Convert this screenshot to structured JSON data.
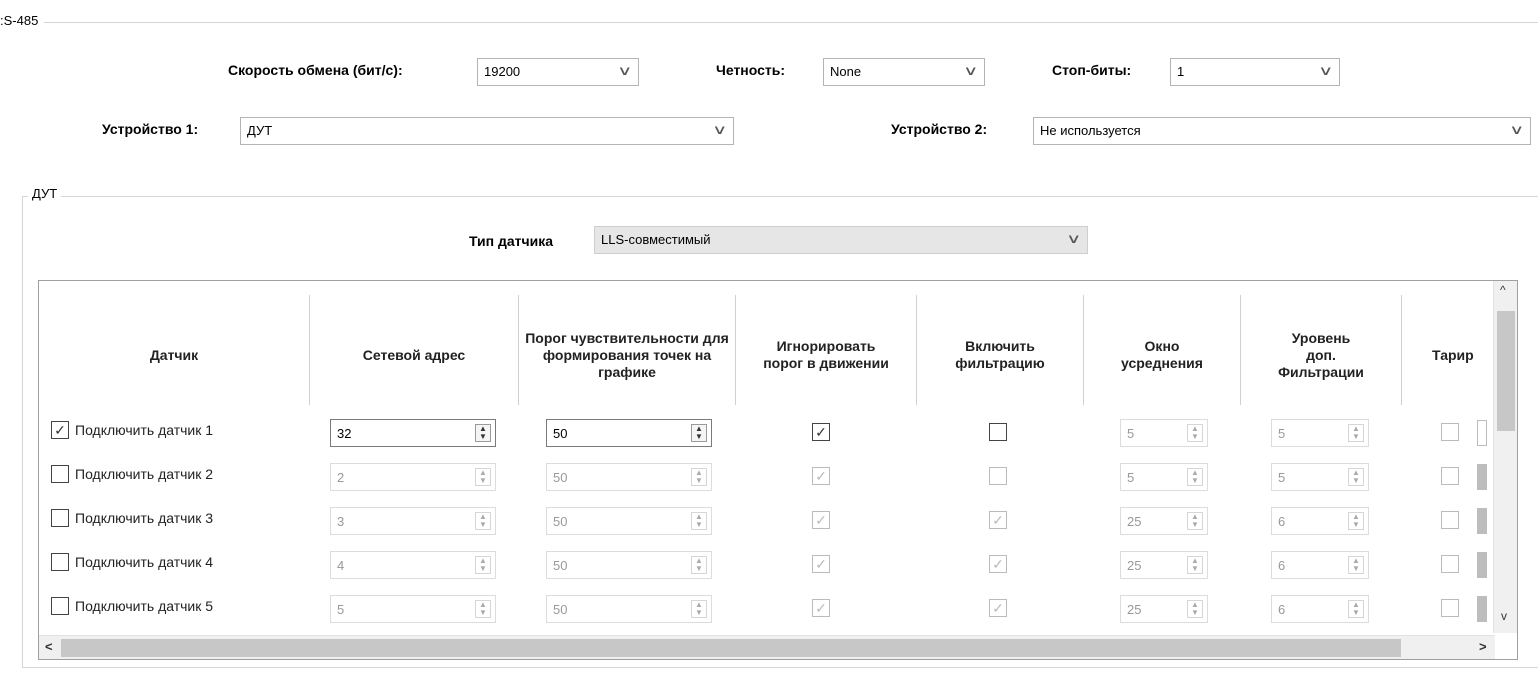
{
  "rs485": {
    "group_label": ":S-485"
  },
  "settings": {
    "baud_label": "Скорость обмена (бит/с):",
    "baud_value": "19200",
    "parity_label": "Четность:",
    "parity_value": "None",
    "stopbits_label": "Стоп-биты:",
    "stopbits_value": "1",
    "device1_label": "Устройство 1:",
    "device1_value": "ДУТ",
    "device2_label": "Устройство 2:",
    "device2_value": "Не используется"
  },
  "dut": {
    "group_label": "ДУТ",
    "sensor_type_label": "Тип датчика",
    "sensor_type_value": "LLS-совместимый"
  },
  "table": {
    "headers": {
      "sensor": "Датчик",
      "address": "Сетевой адрес",
      "threshold": "Порог чувствительности для формирования точек на графике",
      "ignore": "Игнорировать порог в движении",
      "filter": "Включить фильтрацию",
      "window": "Окно усреднения",
      "level": "Уровень доп. Фильтрации",
      "tariff": "Тарир"
    },
    "rows": [
      {
        "label": "Подключить датчик 1",
        "connected": "✓",
        "address": "32",
        "threshold": "50",
        "ignore": "✓",
        "filter": "",
        "window": "5",
        "level": "5"
      },
      {
        "label": "Подключить датчик 2",
        "connected": "",
        "address": "2",
        "threshold": "50",
        "ignore": "✓",
        "filter": "",
        "window": "5",
        "level": "5"
      },
      {
        "label": "Подключить датчик 3",
        "connected": "",
        "address": "3",
        "threshold": "50",
        "ignore": "✓",
        "filter": "✓",
        "window": "25",
        "level": "6"
      },
      {
        "label": "Подключить датчик 4",
        "connected": "",
        "address": "4",
        "threshold": "50",
        "ignore": "✓",
        "filter": "✓",
        "window": "25",
        "level": "6"
      },
      {
        "label": "Подключить датчик 5",
        "connected": "",
        "address": "5",
        "threshold": "50",
        "ignore": "✓",
        "filter": "✓",
        "window": "25",
        "level": "6"
      }
    ]
  },
  "icons": {
    "chevron": "chevron-down-icon",
    "spin": "spin-arrows-icon",
    "scroll_up": "scroll-up-icon",
    "scroll_down": "scroll-down-icon",
    "scroll_left": "scroll-left-icon",
    "scroll_right": "scroll-right-icon"
  },
  "glyphs": {
    "chevron": "∨",
    "spin_up": "▲",
    "spin_down": "▼",
    "up": "^",
    "down": "v",
    "left": "<",
    "right": ">"
  }
}
